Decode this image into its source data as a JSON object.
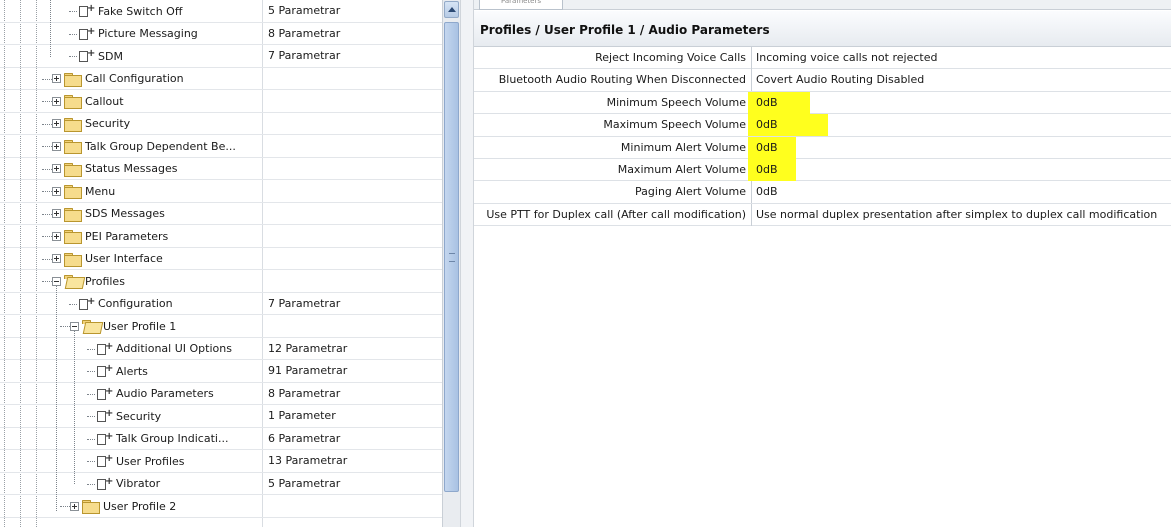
{
  "tree": {
    "rows": [
      {
        "label": "Fake Switch Off",
        "value": "5 Parametrar",
        "type": "param",
        "depth": 1
      },
      {
        "label": "Picture Messaging",
        "value": "8 Parametrar",
        "type": "param",
        "depth": 1
      },
      {
        "label": "SDM",
        "value": "7 Parametrar",
        "type": "param",
        "depth": 1
      },
      {
        "label": "Call Configuration",
        "value": "",
        "type": "folder",
        "depth": 0,
        "expanded": false
      },
      {
        "label": "Callout",
        "value": "",
        "type": "folder",
        "depth": 0,
        "expanded": false
      },
      {
        "label": "Security",
        "value": "",
        "type": "folder",
        "depth": 0,
        "expanded": false
      },
      {
        "label": "Talk Group Dependent Be...",
        "value": "",
        "type": "folder",
        "depth": 0,
        "expanded": false
      },
      {
        "label": "Status Messages",
        "value": "",
        "type": "folder",
        "depth": 0,
        "expanded": false
      },
      {
        "label": "Menu",
        "value": "",
        "type": "folder",
        "depth": 0,
        "expanded": false
      },
      {
        "label": "SDS Messages",
        "value": "",
        "type": "folder",
        "depth": 0,
        "expanded": false
      },
      {
        "label": "PEI Parameters",
        "value": "",
        "type": "folder",
        "depth": 0,
        "expanded": false
      },
      {
        "label": "User Interface",
        "value": "",
        "type": "folder",
        "depth": 0,
        "expanded": false
      },
      {
        "label": "Profiles",
        "value": "",
        "type": "folder",
        "depth": 0,
        "expanded": true
      },
      {
        "label": "Configuration",
        "value": "7 Parametrar",
        "type": "param",
        "depth": 1
      },
      {
        "label": "User Profile 1",
        "value": "",
        "type": "folder",
        "depth": 1,
        "expanded": true
      },
      {
        "label": "Additional UI Options",
        "value": "12 Parametrar",
        "type": "param",
        "depth": 2
      },
      {
        "label": "Alerts",
        "value": "91 Parametrar",
        "type": "param",
        "depth": 2
      },
      {
        "label": "Audio Parameters",
        "value": "8 Parametrar",
        "type": "param",
        "depth": 2
      },
      {
        "label": "Security",
        "value": "1 Parameter",
        "type": "param",
        "depth": 2
      },
      {
        "label": "Talk Group Indicati...",
        "value": "6 Parametrar",
        "type": "param",
        "depth": 2
      },
      {
        "label": "User Profiles",
        "value": "13 Parametrar",
        "type": "param",
        "depth": 2
      },
      {
        "label": "Vibrator",
        "value": "5 Parametrar",
        "type": "param",
        "depth": 2
      },
      {
        "label": "User Profile 2",
        "value": "",
        "type": "folder",
        "depth": 1,
        "expanded": false
      }
    ]
  },
  "right": {
    "tab_label": "Parameters",
    "breadcrumb": "Profiles / User Profile 1 / Audio Parameters",
    "params": [
      {
        "name": "Reject Incoming Voice Calls",
        "value": "Incoming voice calls not rejected",
        "highlight": false
      },
      {
        "name": "Bluetooth Audio Routing When Disconnected",
        "value": "Covert Audio Routing Disabled",
        "highlight": false
      },
      {
        "name": "Minimum Speech Volume",
        "value": "0dB",
        "highlight": true
      },
      {
        "name": "Maximum Speech Volume",
        "value": "0dB",
        "highlight": true
      },
      {
        "name": "Minimum Alert Volume",
        "value": "0dB",
        "highlight": true
      },
      {
        "name": "Maximum Alert Volume",
        "value": "0dB",
        "highlight": true
      },
      {
        "name": "Paging Alert Volume",
        "value": "0dB",
        "highlight": false
      },
      {
        "name": "Use PTT for Duplex call (After call modification)",
        "value": "Use normal duplex presentation after simplex to duplex call modification",
        "highlight": false
      }
    ],
    "highlight_color": "#ffff1e"
  }
}
